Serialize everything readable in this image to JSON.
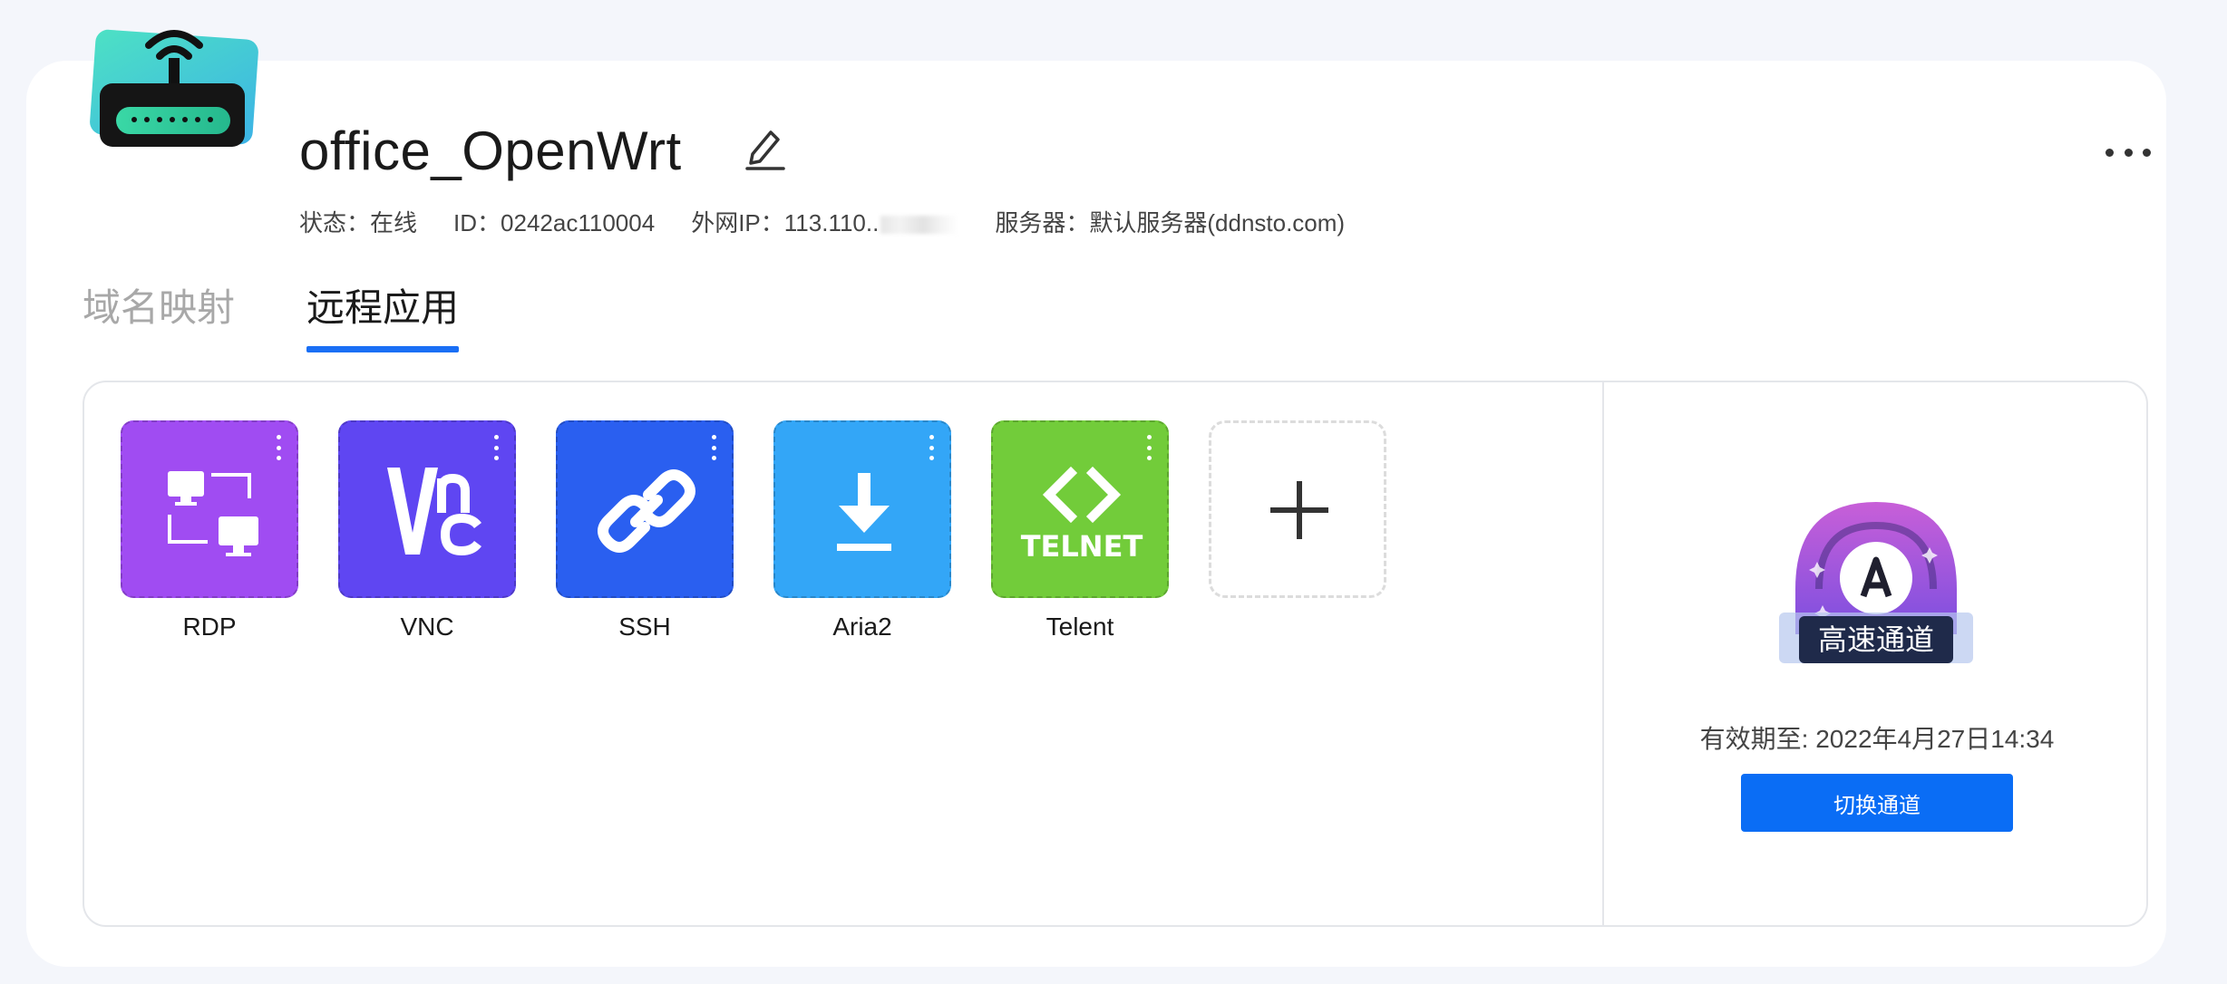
{
  "device": {
    "name": "office_OpenWrt",
    "icon": "router-icon"
  },
  "meta": {
    "status_label": "状态：",
    "status_value": "在线",
    "id_label": "ID：",
    "id_value": "0242ac110004",
    "ip_label": "外网IP：",
    "ip_value": "113.110..",
    "server_label": "服务器：",
    "server_value": "默认服务器(ddnsto.com)"
  },
  "tabs": [
    {
      "label": "域名映射",
      "active": false
    },
    {
      "label": "远程应用",
      "active": true
    }
  ],
  "apps": [
    {
      "label": "RDP",
      "icon": "remote-desktop-icon",
      "color": "#a04cf2"
    },
    {
      "label": "VNC",
      "icon": "vnc-icon",
      "color": "#5f46f2"
    },
    {
      "label": "SSH",
      "icon": "link-icon",
      "color": "#2a5ff0"
    },
    {
      "label": "Aria2",
      "icon": "download-icon",
      "color": "#33a6f7"
    },
    {
      "label": "Telent",
      "icon": "telnet-icon",
      "color": "#72cc3a",
      "glyph_text": "TELNET"
    }
  ],
  "channel": {
    "badge_letter": "A",
    "badge_text": "高速通道",
    "expiry": "有效期至: 2022年4月27日14:34",
    "switch_label": "切换通道"
  },
  "colors": {
    "accent": "#1a6ff5",
    "button": "#0a6df5"
  }
}
